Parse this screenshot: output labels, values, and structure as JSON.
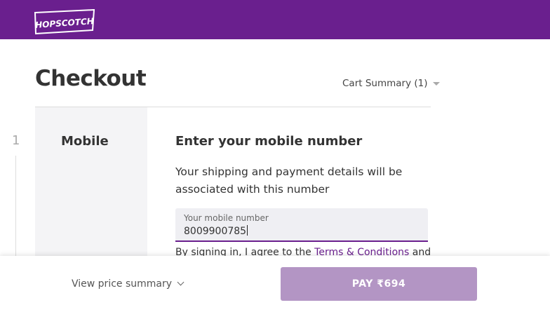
{
  "header": {
    "logo_text": "HOPSCOTCH",
    "brand_color": "#6a1f8e"
  },
  "page": {
    "title": "Checkout"
  },
  "cart_summary": {
    "label": "Cart Summary (1)"
  },
  "step": {
    "number": "1",
    "label": "Mobile"
  },
  "mobile_section": {
    "heading": "Enter your mobile number",
    "description": "Your shipping and payment details will be associated with this number",
    "field_label": "Your mobile number",
    "field_value": "8009900785",
    "terms_prefix": "By signing in, I agree to the ",
    "terms_link": "Terms & Conditions",
    "terms_suffix": " and"
  },
  "bottom_bar": {
    "view_price_label": "View price summary",
    "pay_label": "PAY ₹694",
    "pay_color": "#b395c4"
  }
}
